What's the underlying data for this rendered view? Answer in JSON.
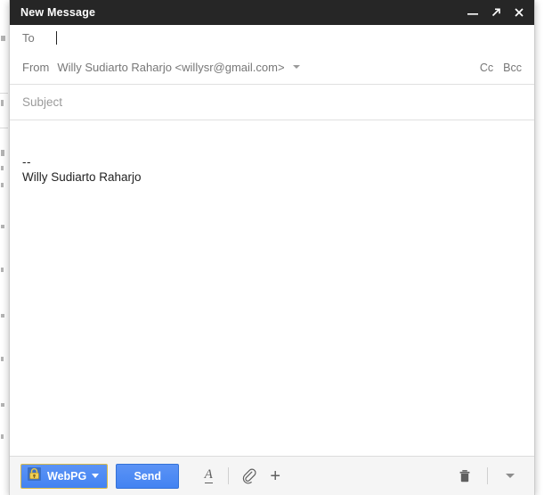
{
  "window": {
    "title": "New Message",
    "controls": [
      {
        "name": "minimize",
        "icon": "minimize-icon",
        "label": "–"
      },
      {
        "name": "popout",
        "icon": "expand-arrow-icon",
        "label": "↗"
      },
      {
        "name": "close",
        "icon": "close-icon",
        "label": "✕"
      }
    ]
  },
  "fields": {
    "to_label": "To",
    "to_value": "",
    "from_label": "From",
    "from_value": "Willy Sudiarto Raharjo <willysr@gmail.com>",
    "cc_label": "Cc",
    "bcc_label": "Bcc",
    "subject_placeholder": "Subject",
    "subject_value": ""
  },
  "body": {
    "signature_separator": "--",
    "signature_name": "Willy Sudiarto Raharjo"
  },
  "toolbar": {
    "webpg_label": "WebPG",
    "send_label": "Send",
    "format_label": "A",
    "plus_label": "+",
    "icons": {
      "webpg": "lock-key-icon",
      "format": "text-format-icon",
      "attach": "paperclip-icon",
      "insert": "plus-icon",
      "discard": "trash-icon",
      "more": "chevron-down-icon"
    }
  },
  "colors": {
    "titlebar_bg": "#262626",
    "button_blue": "#4285f4",
    "webpg_border": "#d8bb49",
    "toolbar_bg": "#f5f5f5",
    "label_gray": "#777777",
    "body_text": "#222222"
  }
}
